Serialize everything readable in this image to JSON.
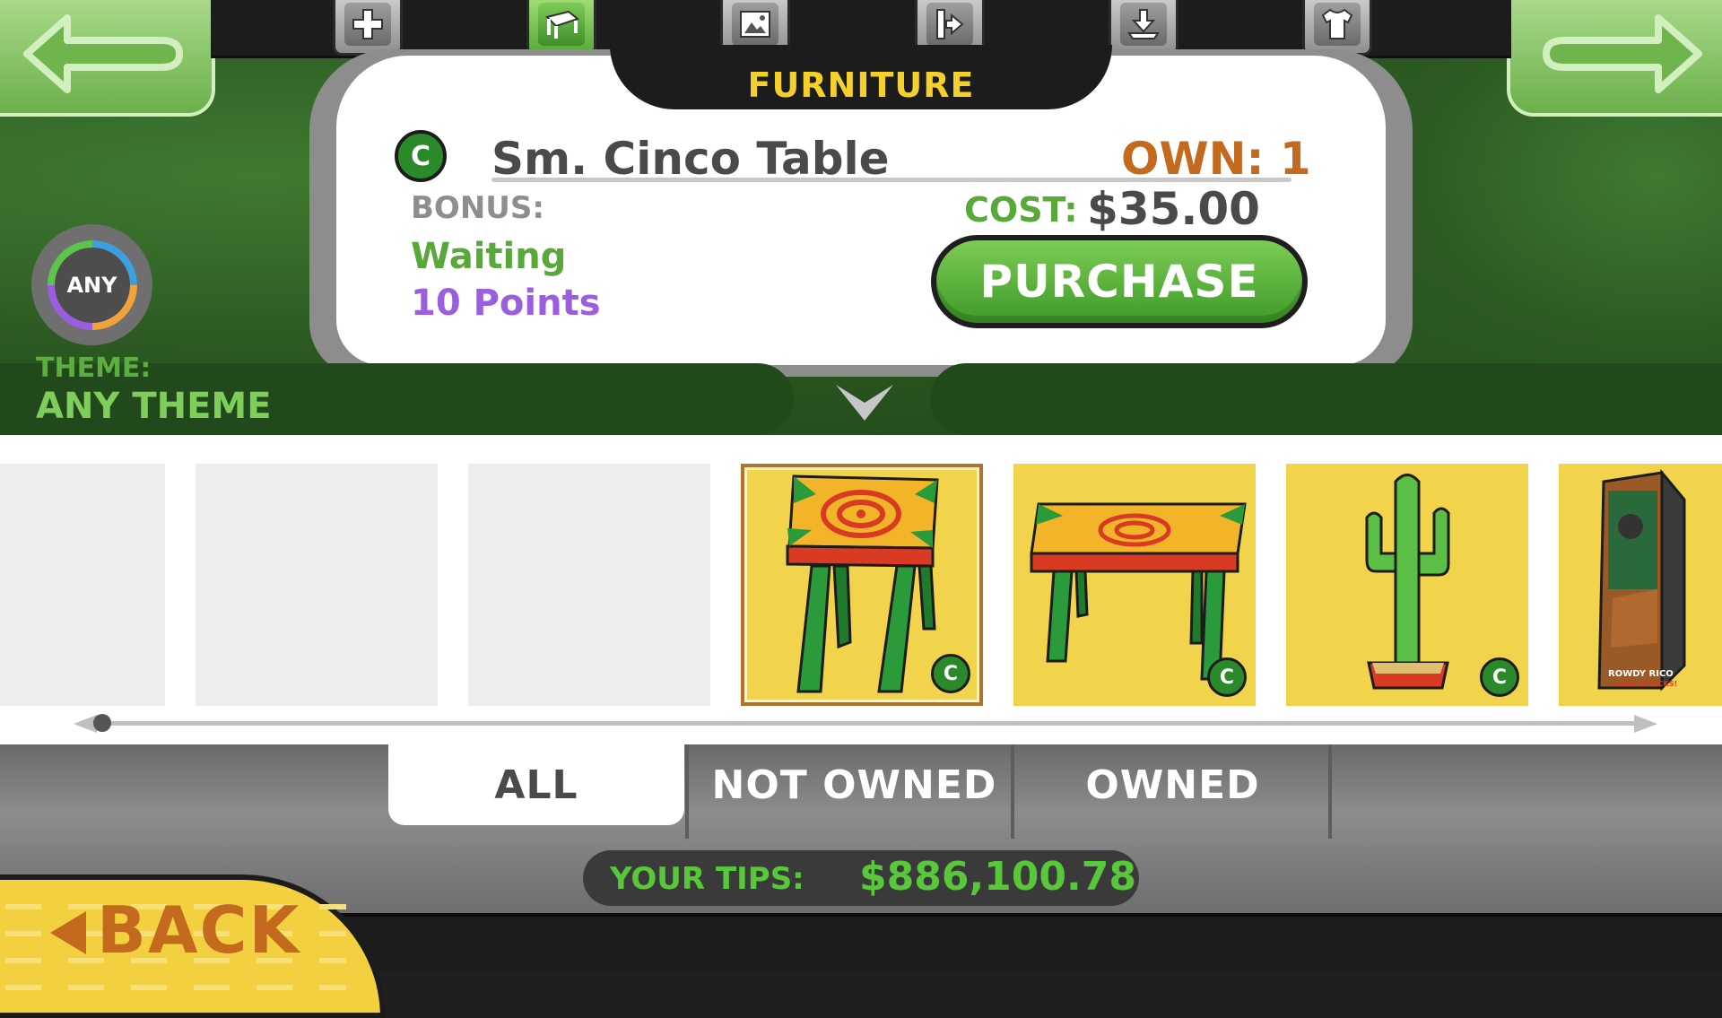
{
  "header": {
    "category_title": "FURNITURE",
    "tabs": [
      {
        "name": "add",
        "icon": "plus-icon"
      },
      {
        "name": "furniture",
        "icon": "table-icon",
        "active": true
      },
      {
        "name": "wallpaper",
        "icon": "picture-icon"
      },
      {
        "name": "door",
        "icon": "door-exit-icon"
      },
      {
        "name": "floor",
        "icon": "download-floor-icon"
      },
      {
        "name": "clothing",
        "icon": "shirt-icon"
      }
    ]
  },
  "item": {
    "name": "Sm. Cinco Table",
    "own": "OWN: 1",
    "bonus_label": "BONUS:",
    "bonus_value": "Waiting",
    "bonus_points": "10 Points",
    "cost_label": "COST:",
    "cost_value": "$35.00",
    "purchase_label": "PURCHASE",
    "badge": "C"
  },
  "theme": {
    "ring_label": "ANY",
    "label": "THEME:",
    "value": "ANY THEME"
  },
  "catalog": {
    "badge": "C",
    "items": [
      {
        "state": "empty"
      },
      {
        "state": "empty"
      },
      {
        "state": "empty"
      },
      {
        "state": "item",
        "name": "small cinco table",
        "selected": true
      },
      {
        "state": "item",
        "name": "cinco table"
      },
      {
        "state": "item",
        "name": "cactus"
      },
      {
        "state": "item",
        "name": "rowdy rico arcade",
        "text1": "ROWDY RICO",
        "text2": "CHILI ATTACKS!"
      }
    ]
  },
  "filters": {
    "all": "ALL",
    "not_owned": "NOT OWNED",
    "owned": "OWNED"
  },
  "tips": {
    "label": "YOUR TIPS:",
    "value": "$886,100.78"
  },
  "back": {
    "label": "BACK"
  },
  "colors": {
    "accent_green": "#58a83a",
    "gold": "#f5d02b",
    "orange": "#c36a1f",
    "purple": "#9c5ee0"
  }
}
